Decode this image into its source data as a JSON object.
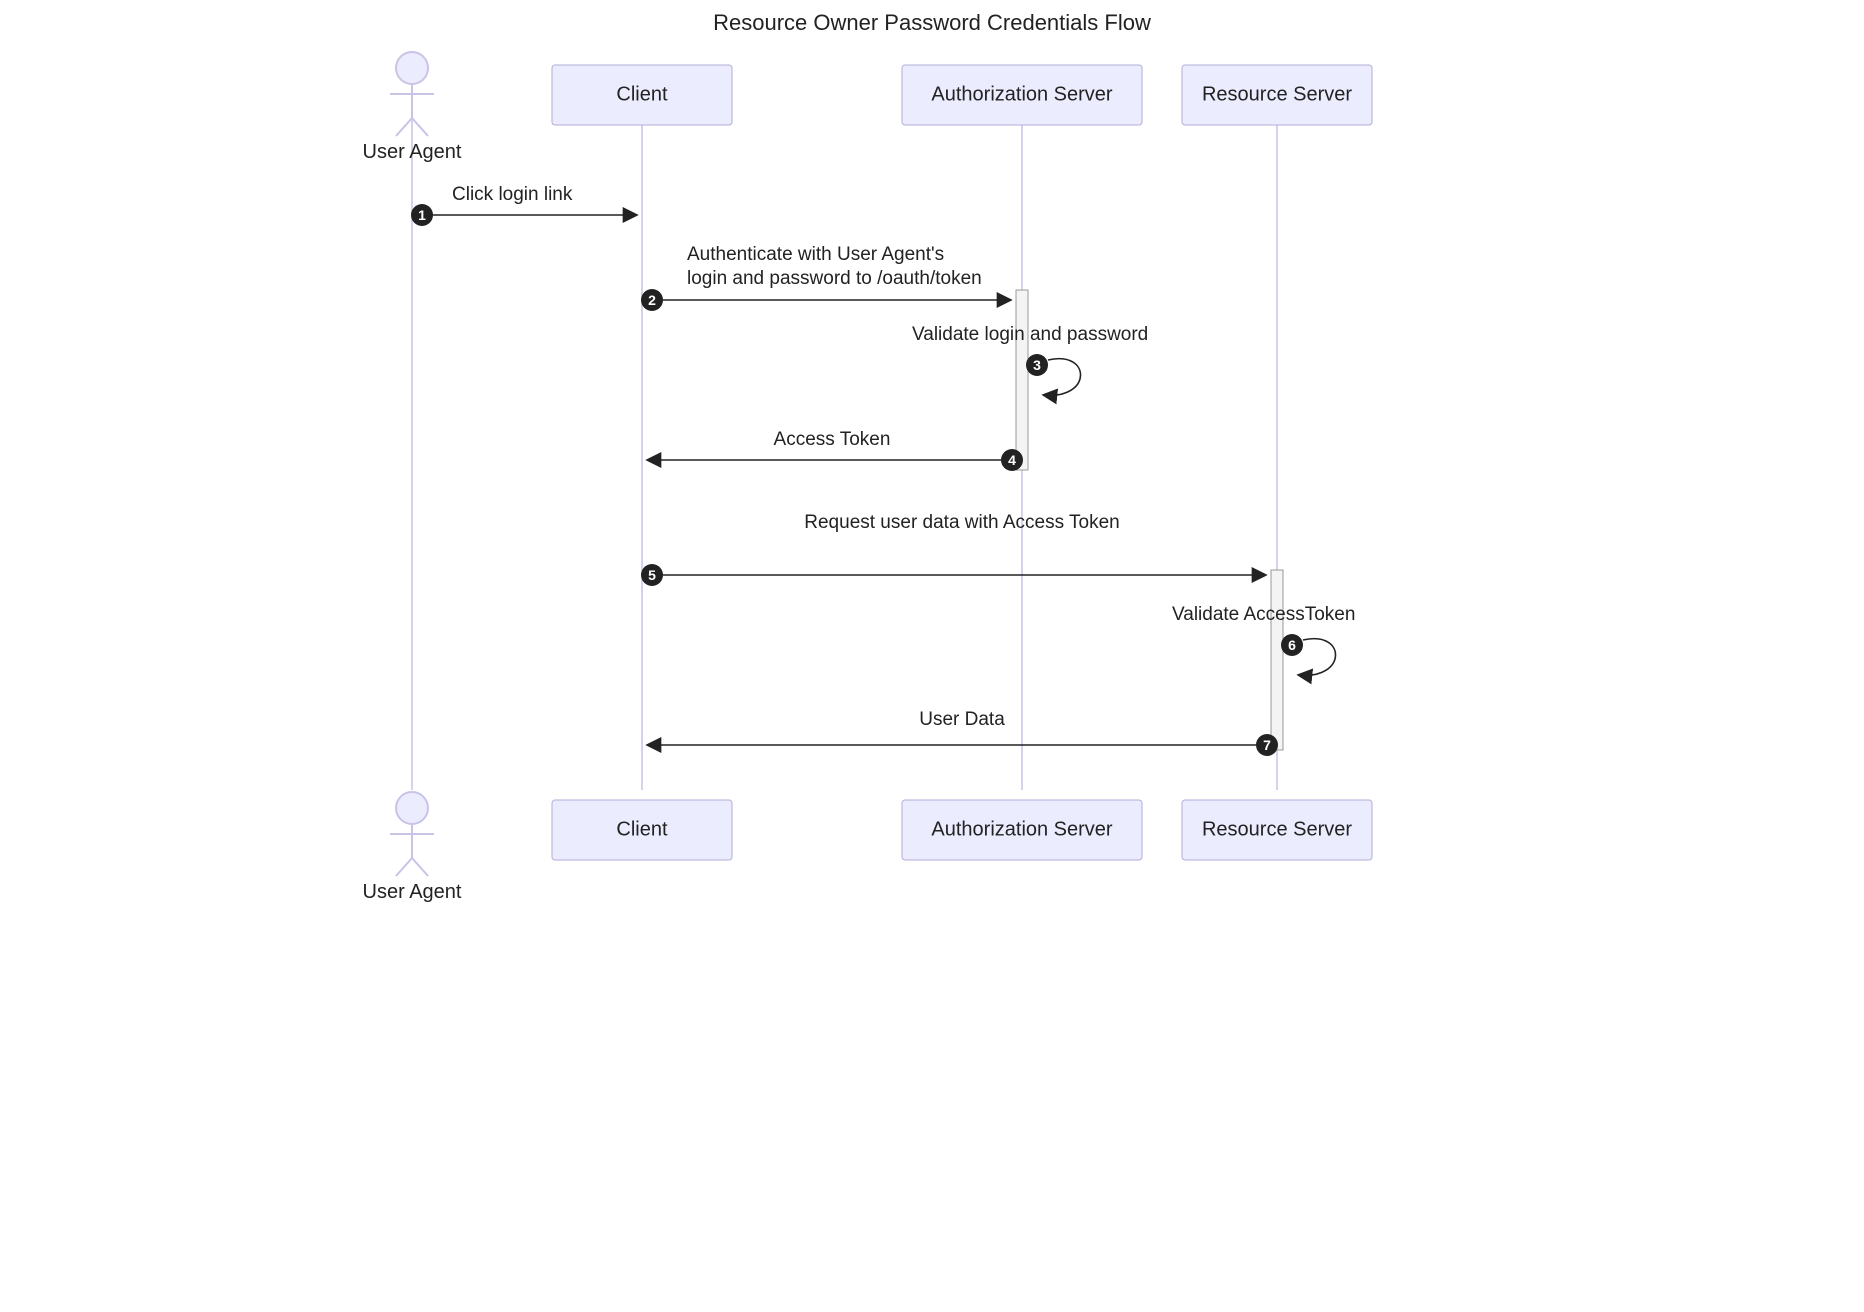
{
  "title": "Resource Owner Password Credentials Flow",
  "participants": {
    "userAgent": "User Agent",
    "client": "Client",
    "authServer": "Authorization Server",
    "resourceServer": "Resource Server"
  },
  "messages": {
    "m1": {
      "num": "1",
      "text": "Click login link"
    },
    "m2": {
      "num": "2",
      "line1": "Authenticate with User Agent's",
      "line2": "login and password to /oauth/token"
    },
    "m3": {
      "num": "3",
      "text": "Validate login and password"
    },
    "m4": {
      "num": "4",
      "text": "Access Token"
    },
    "m5": {
      "num": "5",
      "text": "Request user data with Access Token"
    },
    "m6": {
      "num": "6",
      "text": "Validate AccessToken"
    },
    "m7": {
      "num": "7",
      "text": "User Data"
    }
  }
}
